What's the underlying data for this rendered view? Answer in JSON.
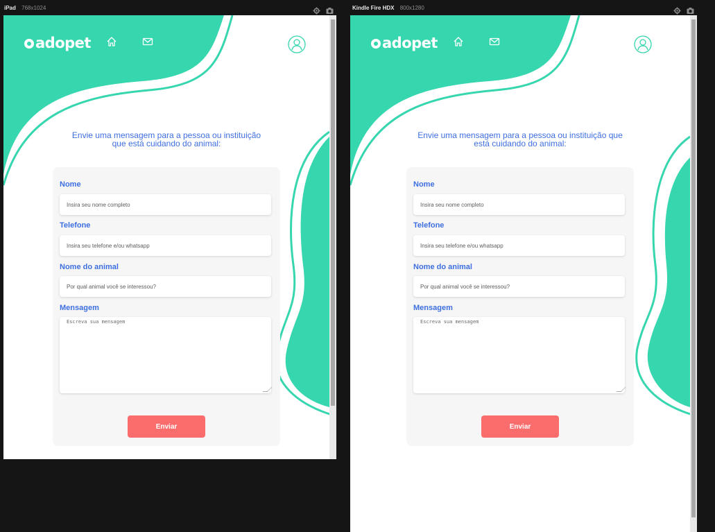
{
  "devices": [
    {
      "name": "iPad",
      "dims": "768x1024"
    },
    {
      "name": "Kindle Fire HDX",
      "dims": "800x1280"
    }
  ],
  "brand": {
    "logo_text": "adopet",
    "primary_color": "#36d6ae",
    "accent_color": "#3e6fe0",
    "button_color": "#fb6d6d"
  },
  "nav": {
    "home_icon": "home-icon",
    "messages_icon": "mail-icon",
    "profile_icon": "user-profile-icon"
  },
  "form": {
    "heading_line1": "Envie uma mensagem para a pessoa ou instituição",
    "heading_line2": "que está cuidando do animal:",
    "heading_line1_wide": "Envie uma mensagem para a pessoa ou instituição que",
    "heading_line2_wide": "está cuidando do animal:",
    "name_label": "Nome",
    "name_placeholder": "Insira seu nome completo",
    "phone_label": "Telefone",
    "phone_placeholder": "Insira seu telefone e/ou whatsapp",
    "animal_label": "Nome do animal",
    "animal_placeholder": "Por qual animal você se interessou?",
    "message_label": "Mensagem",
    "message_placeholder": "Escreva sua mensagem",
    "submit_label": "Enviar"
  }
}
